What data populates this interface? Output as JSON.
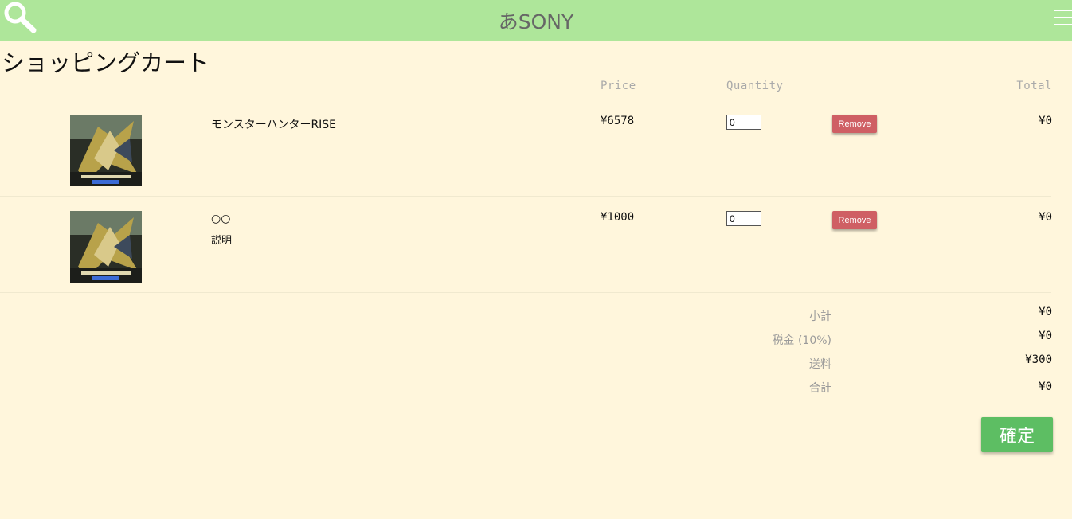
{
  "header": {
    "brand": "あSONY",
    "search_icon": "search-icon",
    "menu_icon": "hamburger-menu-icon",
    "background_color": "#aee69a"
  },
  "page": {
    "title": "ショッピングカート",
    "background_color": "#fff6dc"
  },
  "table": {
    "columns": {
      "price": "Price",
      "quantity": "Quantity",
      "total": "Total"
    },
    "items": [
      {
        "name": "モンスターハンターRISE",
        "description": "",
        "price": "¥6578",
        "quantity": "0",
        "remove_label": "Remove",
        "total": "¥0",
        "image_alt": "MONSTER HUNTER RISE"
      },
      {
        "name": "○○",
        "description": "説明",
        "price": "¥1000",
        "quantity": "0",
        "remove_label": "Remove",
        "total": "¥0",
        "image_alt": "MONSTER HUNTER RISE"
      }
    ]
  },
  "summary": {
    "subtotal_label": "小計",
    "subtotal_value": "¥0",
    "tax_label": "税金 (10%)",
    "tax_value": "¥0",
    "shipping_label": "送料",
    "shipping_value": "¥300",
    "grand_total_label": "合計",
    "grand_total_value": "¥0"
  },
  "actions": {
    "confirm_label": "確定",
    "remove_color": "#cf5f64",
    "confirm_color": "#5dbe63"
  }
}
